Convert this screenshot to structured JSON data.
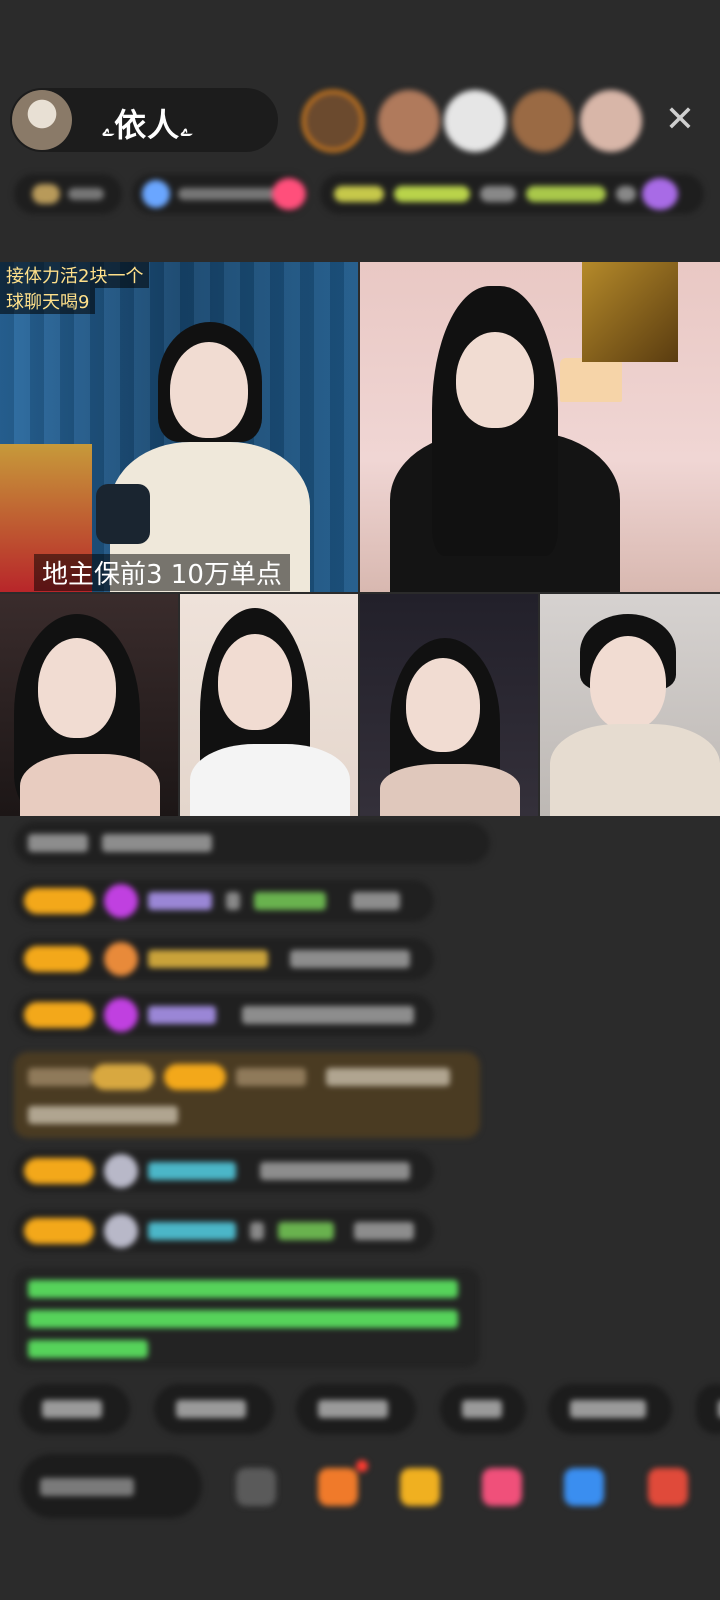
{
  "host": {
    "name": "ۦ依人ۦ"
  },
  "overlays": {
    "tile1_line1": "接体力活2块一个",
    "tile1_line2": "球聊天喝9",
    "tile1_banner": "地主保前3 10万单点"
  },
  "colors": {
    "background": "#2b2b2b",
    "level_badge": "#f3a81a",
    "notice_green": "#56d35a",
    "rank_ring": "#f08a1a"
  }
}
